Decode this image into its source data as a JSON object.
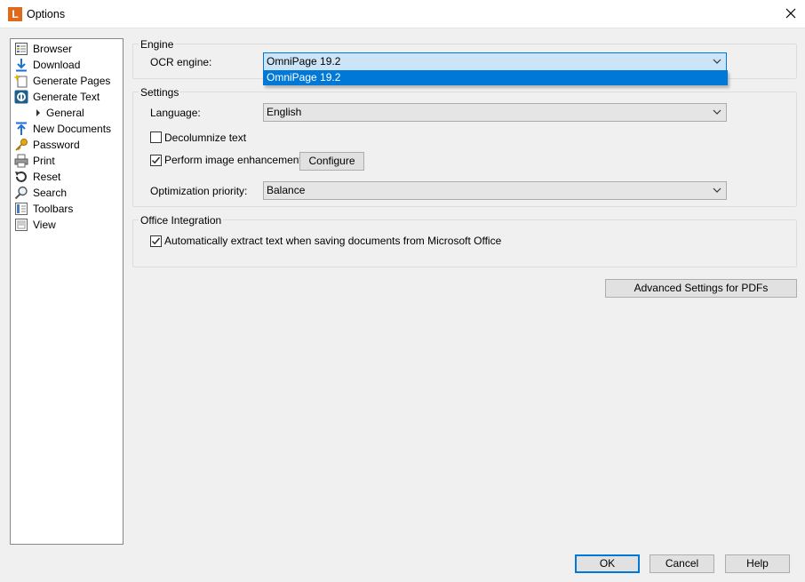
{
  "window": {
    "title": "Options",
    "app_icon_letter": "L",
    "accent_color": "#0078d7"
  },
  "sidebar": {
    "items": [
      {
        "label": "Browser",
        "icon": "browser-icon"
      },
      {
        "label": "Download",
        "icon": "download-arrow-icon"
      },
      {
        "label": "Generate Pages",
        "icon": "generate-pages-icon"
      },
      {
        "label": "Generate Text",
        "icon": "ocr-text-icon"
      },
      {
        "label": "General",
        "icon": "chevron-right-icon",
        "child": true
      },
      {
        "label": "New Documents",
        "icon": "upload-arrow-icon"
      },
      {
        "label": "Password",
        "icon": "key-icon"
      },
      {
        "label": "Print",
        "icon": "printer-icon"
      },
      {
        "label": "Reset",
        "icon": "reset-icon"
      },
      {
        "label": "Search",
        "icon": "magnifier-icon"
      },
      {
        "label": "Toolbars",
        "icon": "toolbars-icon"
      },
      {
        "label": "View",
        "icon": "view-icon"
      }
    ]
  },
  "engine": {
    "title": "Engine",
    "ocr_label": "OCR engine:",
    "ocr_value": "OmniPage 19.2",
    "options": [
      "OmniPage 19.2"
    ]
  },
  "settings": {
    "title": "Settings",
    "language_label": "Language:",
    "language_value": "English",
    "decolumnize_label": "Decolumnize text",
    "decolumnize_checked": false,
    "enhancement_label": "Perform image enhancement",
    "enhancement_checked": true,
    "configure_label": "Configure",
    "priority_label": "Optimization priority:",
    "priority_value": "Balance"
  },
  "office": {
    "title": "Office Integration",
    "extract_label": "Automatically extract text when saving documents from Microsoft Office",
    "extract_checked": true
  },
  "buttons": {
    "advanced": "Advanced Settings for PDFs",
    "ok": "OK",
    "cancel": "Cancel",
    "help": "Help"
  }
}
